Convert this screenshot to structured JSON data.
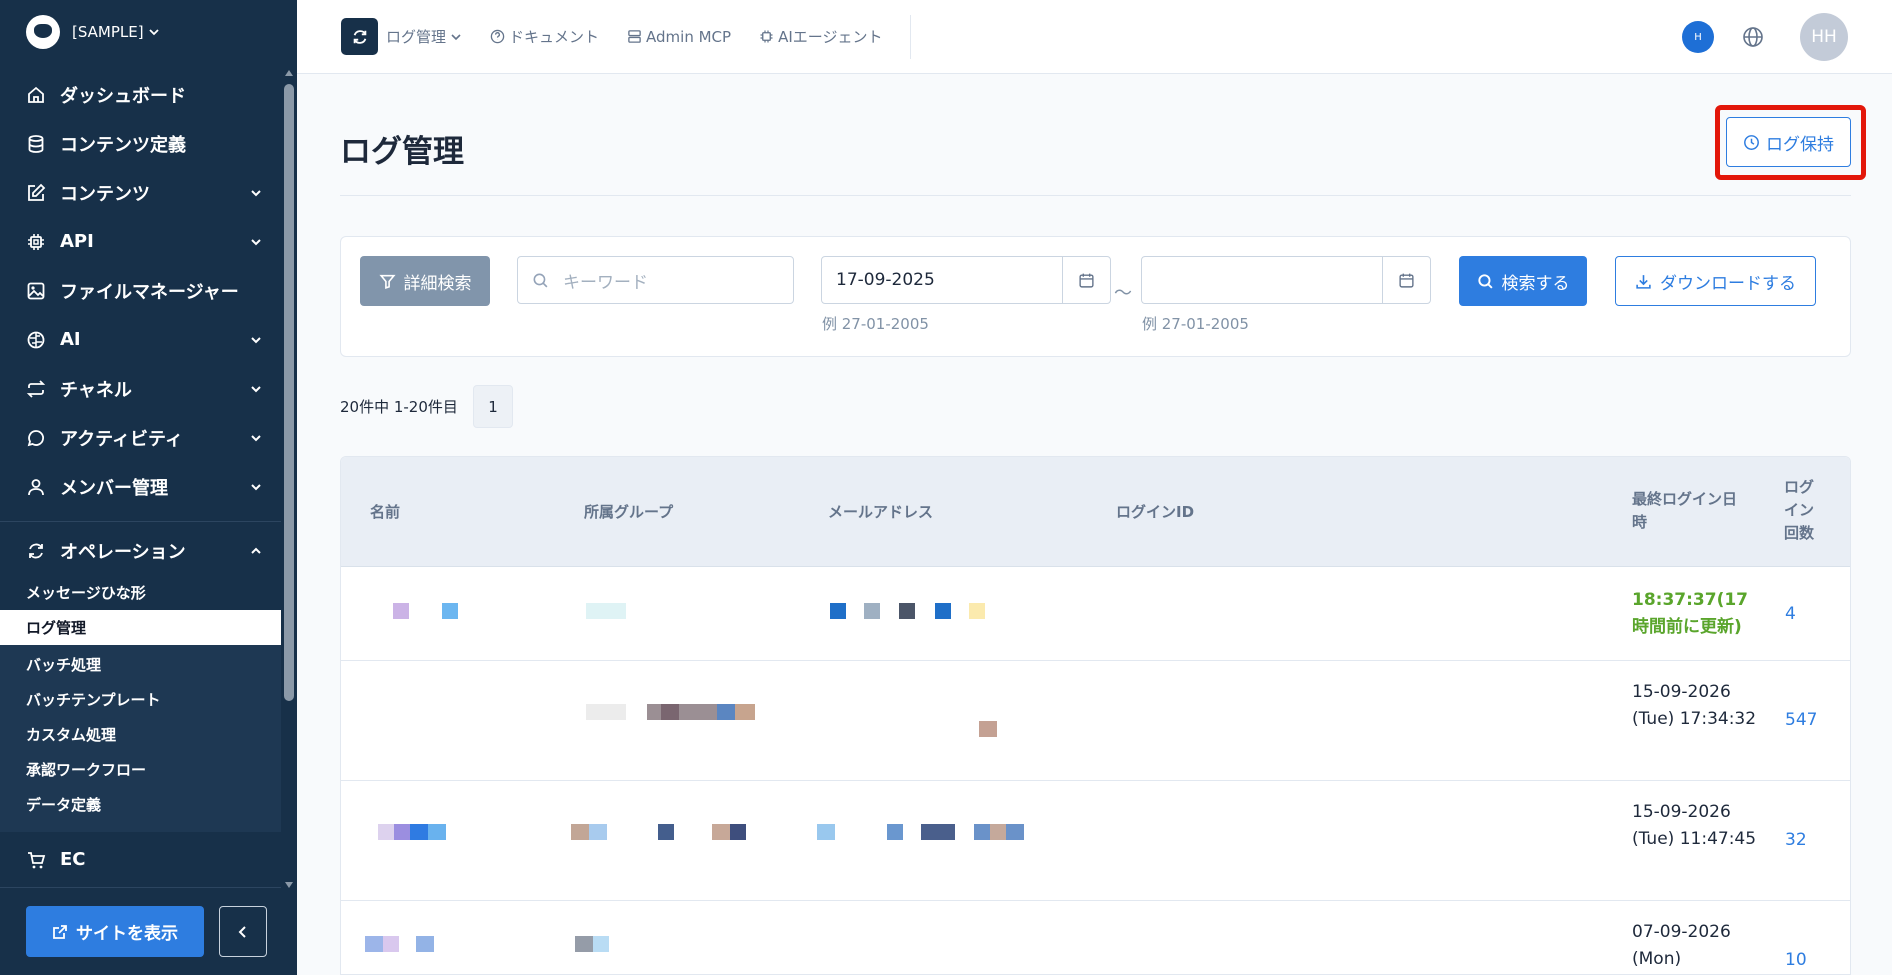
{
  "sidebar": {
    "project": "[SAMPLE]",
    "items": [
      {
        "label": "ダッシュボード",
        "icon": "home-icon"
      },
      {
        "label": "コンテンツ定義",
        "icon": "database-icon"
      },
      {
        "label": "コンテンツ",
        "icon": "edit-icon"
      },
      {
        "label": "API",
        "icon": "chip-icon"
      },
      {
        "label": "ファイルマネージャー",
        "icon": "image-icon"
      },
      {
        "label": "AI",
        "icon": "brain-icon"
      },
      {
        "label": "チャネル",
        "icon": "repeat-icon"
      },
      {
        "label": "アクティビティ",
        "icon": "chat-icon"
      },
      {
        "label": "メンバー管理",
        "icon": "user-icon"
      }
    ],
    "operations": {
      "label": "オペレーション",
      "sub_items": [
        "メッセージひな形",
        "ログ管理",
        "バッチ処理",
        "バッチテンプレート",
        "カスタム処理",
        "承認ワークフロー",
        "データ定義"
      ]
    },
    "ec_label": "EC",
    "site_button": "サイトを表示"
  },
  "topbar": {
    "current": "ログ管理",
    "docs": "ドキュメント",
    "admin_mcp": "Admin MCP",
    "ai_agent": "AIエージェント",
    "small_avatar": "H",
    "avatar": "HH"
  },
  "main": {
    "title": "ログ管理",
    "retention_button": "ログ保持",
    "filter": {
      "detail_button": "詳細検索",
      "keyword_placeholder": "キーワード",
      "date_from": "17-09-2025",
      "date_to": "",
      "date_hint_from": "例 27-01-2005",
      "date_hint_to": "例 27-01-2005",
      "tilde": "～",
      "search_button": "検索する",
      "download_button": "ダウンロードする"
    },
    "count_text": "20件中 1-20件目",
    "page": "1",
    "table": {
      "headers": [
        "名前",
        "所属グループ",
        "メールアドレス",
        "ログインID",
        "最終ログイン日時",
        "ログイン回数"
      ],
      "rows": [
        {
          "last_login": "18:37:37(17時間前に更新)",
          "count": "4"
        },
        {
          "last_login": "15-09-2026 (Tue) 17:34:32",
          "count": "547"
        },
        {
          "last_login": "15-09-2026 (Tue) 11:47:45",
          "count": "32"
        },
        {
          "last_login": "07-09-2026 (Mon)",
          "count": "10"
        }
      ]
    }
  }
}
